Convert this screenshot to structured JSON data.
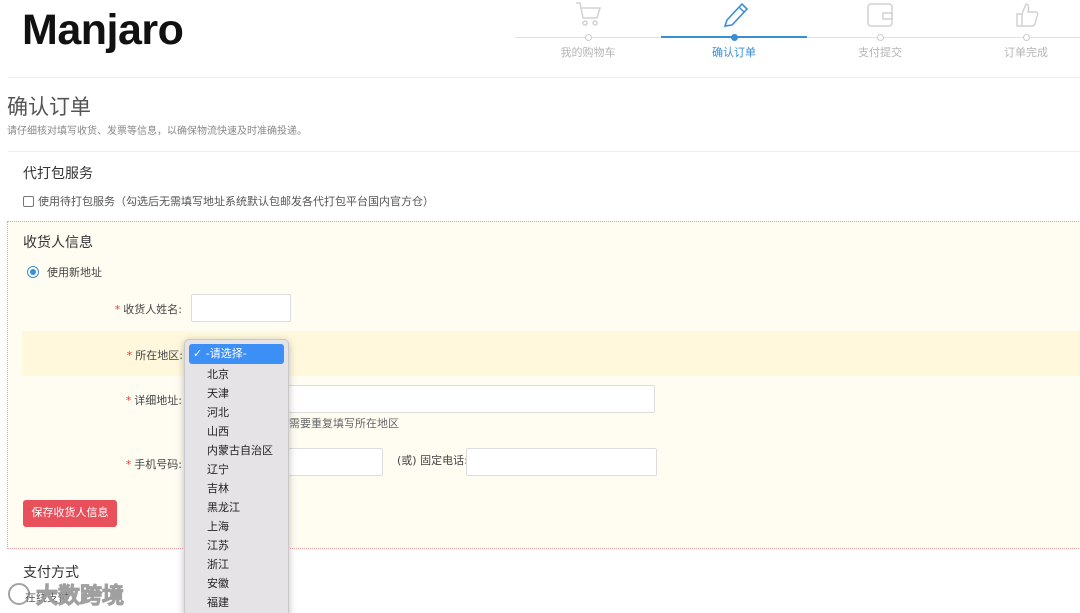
{
  "header": {
    "logo_text": "Manjaro",
    "steps": [
      {
        "label": "我的购物车",
        "icon": "cart-icon"
      },
      {
        "label": "确认订单",
        "icon": "pencil-icon"
      },
      {
        "label": "支付提交",
        "icon": "wallet-icon"
      },
      {
        "label": "订单完成",
        "icon": "thumbs-up-icon"
      }
    ],
    "active_step": 1,
    "accent_color": "#3a8ed4"
  },
  "page": {
    "title": "确认订单",
    "subtitle": "请仔细核对填写收货、发票等信息，以确保物流快速及时准确投递。"
  },
  "packing": {
    "title": "代打包服务",
    "checkbox_label": "使用待打包服务（勾选后无需填写地址系统默认包邮发各代打包平台国内官方仓）",
    "checked": false
  },
  "receiver": {
    "title": "收货人信息",
    "use_new_address_label": "使用新地址",
    "name_label": "收货人姓名:",
    "region_label": "所在地区:",
    "address_label": "详细地址:",
    "address_hint": "需要重复填写所在地区",
    "mobile_label": "手机号码:",
    "phone_label": "(或) 固定电话:",
    "required_mark": "*",
    "save_button": "保存收货人信息",
    "region_dropdown": {
      "selected": "-请选择-",
      "options": [
        "北京",
        "天津",
        "河北",
        "山西",
        "内蒙古自治区",
        "辽宁",
        "吉林",
        "黑龙江",
        "上海",
        "江苏",
        "浙江",
        "安徽",
        "福建"
      ]
    }
  },
  "payment": {
    "title": "支付方式",
    "sub": "在线支付"
  },
  "watermark": {
    "text": "大数跨境"
  }
}
